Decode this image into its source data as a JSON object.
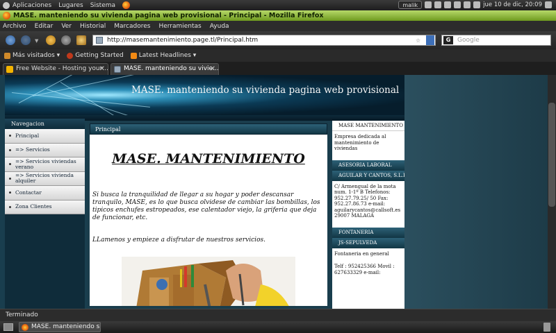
{
  "gnome_panel": {
    "menus": [
      "Aplicaciones",
      "Lugares",
      "Sistema"
    ],
    "user": "malik",
    "clock": "jue 10 de dic, 20:09"
  },
  "window": {
    "title": "MASE. manteniendo su vivienda pagina web provisional - Principal - Mozilla Firefox"
  },
  "menubar": [
    "Archivo",
    "Editar",
    "Ver",
    "Historial",
    "Marcadores",
    "Herramientas",
    "Ayuda"
  ],
  "navbar": {
    "url": "http://masemantenimiento.page.tl/Principal.htm",
    "search_placeholder": "Google",
    "search_engine_icon": "G"
  },
  "bookmarks": [
    "Más visitados ▾",
    "Getting Started",
    "Latest Headlines ▾"
  ],
  "tabs": [
    {
      "label": "Free Website - Hosting your ...",
      "active": false
    },
    {
      "label": "MASE. manteniendo su vivie...",
      "active": true
    }
  ],
  "site": {
    "title": "MASE. manteniendo su vivienda pagina web provisional",
    "nav_heading": "Navegacion",
    "nav_items": [
      "Principal",
      "=> Servicios",
      "=> Servicios viviendas verano",
      "=> Servicios vivienda alquiler",
      "Contactar",
      "Zona Clientes"
    ],
    "content_heading": "Principal",
    "brand": "MASE. MANTENIMIENTO",
    "intro": "Si busca la tranquilidad de llegar a su hogar y poder descansar tranquilo, MASE, es lo que busca olvidese de cambiar las bombillas, los tipicos enchufes estropeados, ese calentador viejo, la griferia que deja de funcionar, etc.",
    "call": "LLamenos y empieze a disfrutar de nuestros servicios.",
    "right": {
      "h1": "MASE MANTENIMIENTO",
      "t1": "Empresa dedicada al mantenimiento de viviendas",
      "h2": "ASESORIA LABORAL",
      "h3": "AGUILAR Y CANTOS, S.L.P",
      "t3": "C/ Armengual de la mota num. 1-1º B Telefonos: 952.27.79.25/ 50 Fax: 952.27.86.73 e-mail: aguilarycantos@callsoft.es 29007 MALAGA",
      "h4": "FONTANERIA",
      "h5": "JS-SEPULVEDA",
      "t5a": "Fontaneria en general",
      "t5b": "Telf : 952425366 Movil : 627633329 e-mail:"
    }
  },
  "statusbar": "Terminado",
  "taskbar": {
    "item": "MASE. manteniendo s..."
  }
}
